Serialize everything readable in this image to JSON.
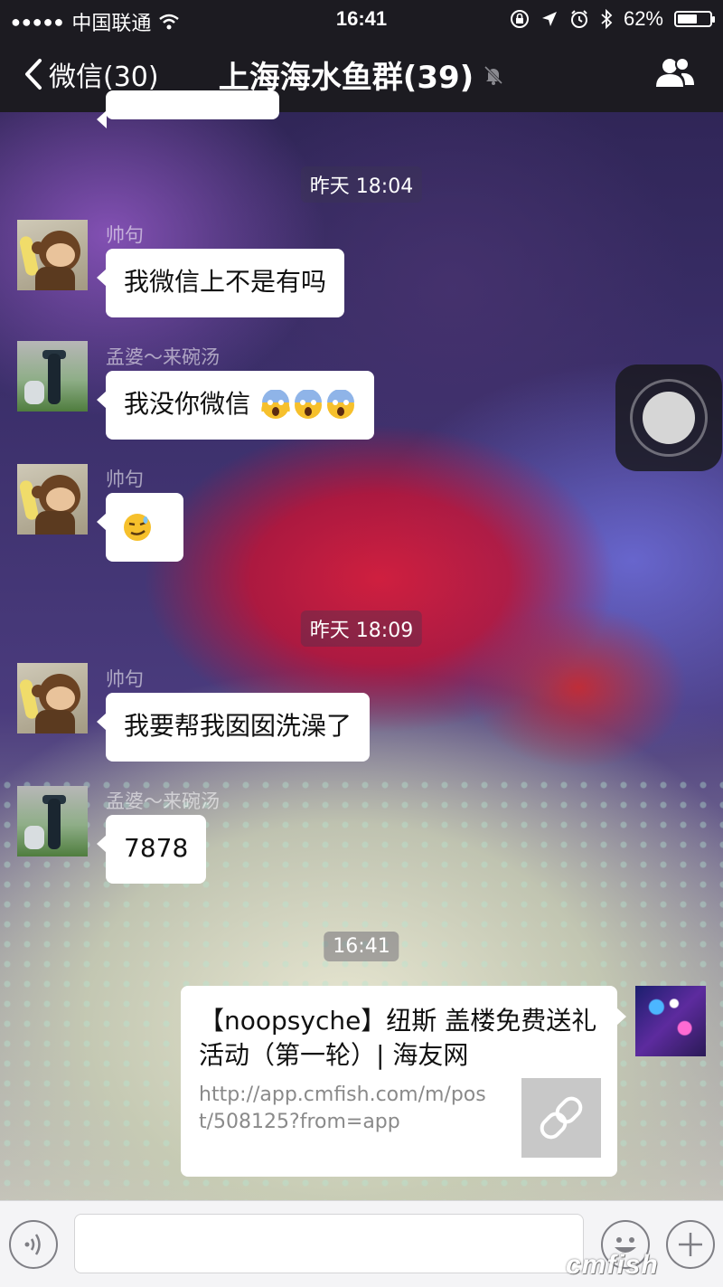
{
  "status_bar": {
    "signal": "●●●●●",
    "carrier": "中国联通",
    "time": "16:41",
    "battery": "62%",
    "battery_level": 0.62
  },
  "nav": {
    "back_label": "微信(30)",
    "title": "上海海水鱼群(39)"
  },
  "messages": [
    {
      "type": "time",
      "text": "昨天 18:04"
    },
    {
      "type": "left",
      "sender": "帅句",
      "text": "我微信上不是有吗"
    },
    {
      "type": "left",
      "sender": "孟婆～来碗汤",
      "text": "我没你微信"
    },
    {
      "type": "left",
      "sender": "帅句",
      "emoji": "smirk"
    },
    {
      "type": "time",
      "text": "昨天 18:09"
    },
    {
      "type": "left",
      "sender": "帅句",
      "text": "我要帮我囡囡洗澡了"
    },
    {
      "type": "left",
      "sender": "孟婆～来碗汤",
      "text": "7878"
    },
    {
      "type": "time",
      "text": "16:41"
    },
    {
      "type": "link",
      "title": "【noopsyche】纽斯 盖楼免费送礼活动（第一轮）| 海友网",
      "url": "http://app.cmfish.com/m/post/508125?from=app"
    }
  ],
  "input_bar": {
    "placeholder": ""
  },
  "watermark": "cmfish",
  "colors": {
    "bar": "#1c1b21",
    "bubble": "#ffffff",
    "input_bg": "#f4f4f6"
  }
}
